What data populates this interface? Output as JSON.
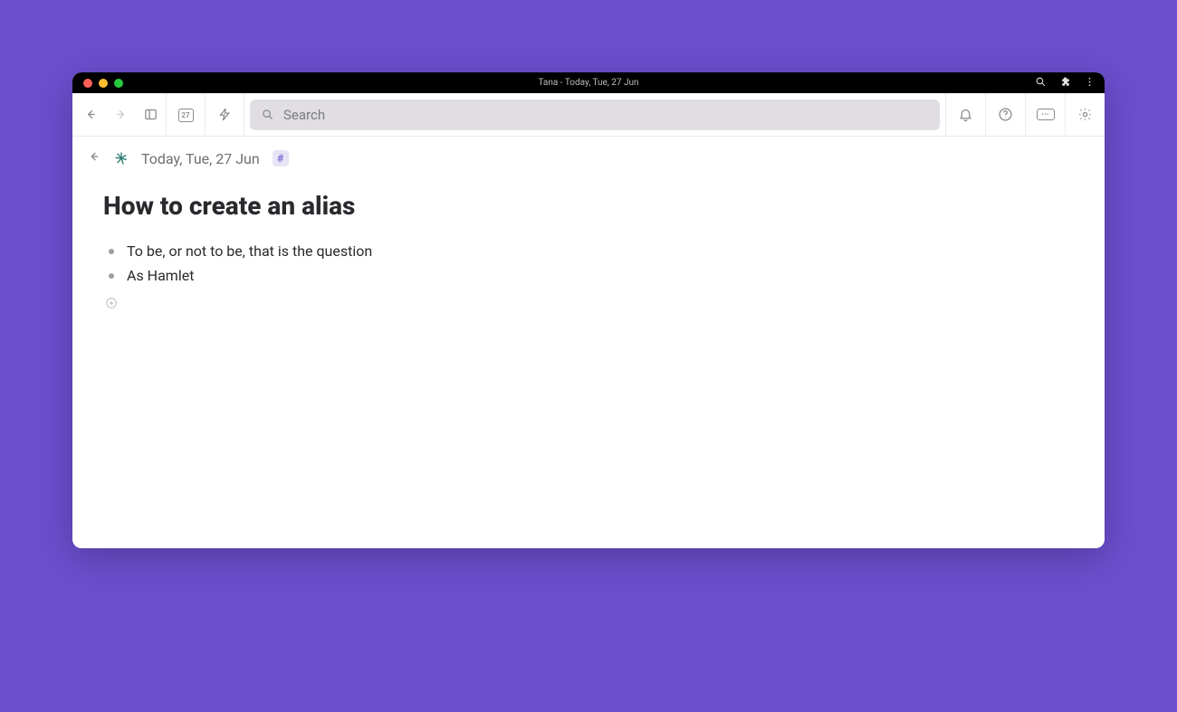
{
  "titlebar": {
    "title": "Tana - Today, Tue, 27 Jun"
  },
  "toolbar": {
    "calendar_day": "27",
    "search_placeholder": "Search"
  },
  "breadcrumb": {
    "text": "Today, Tue, 27 Jun",
    "tag": "#"
  },
  "page": {
    "title": "How to create an alias",
    "bullets": [
      "To be, or not to be, that is the question",
      "As Hamlet"
    ]
  }
}
